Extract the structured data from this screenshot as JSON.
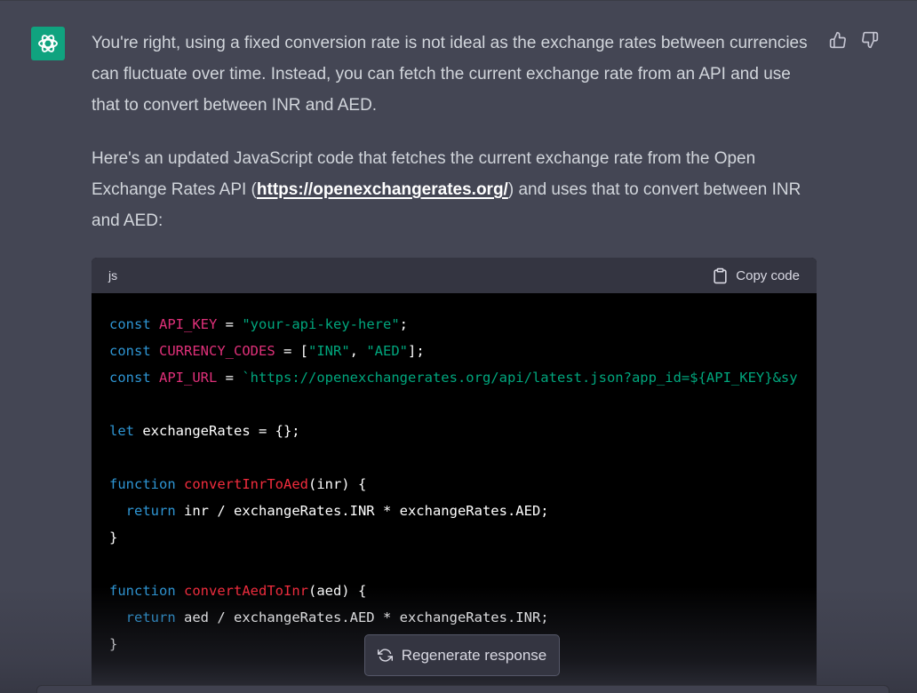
{
  "message": {
    "paragraph1": "You're right, using a fixed conversion rate is not ideal as the exchange rates between currencies can fluctuate over time. Instead, you can fetch the current exchange rate from an API and use that to convert between INR and AED.",
    "paragraph2_before": "Here's an updated JavaScript code that fetches the current exchange rate from the Open Exchange Rates API (",
    "paragraph2_link": "https://openexchangerates.org/",
    "paragraph2_after": ") and uses that to convert between INR and AED:"
  },
  "code": {
    "language": "js",
    "copy_label": "Copy code",
    "lines": [
      [
        {
          "t": "const",
          "c": "kw"
        },
        {
          "t": " "
        },
        {
          "t": "API_KEY",
          "c": "var"
        },
        {
          "t": " = "
        },
        {
          "t": "\"your-api-key-here\"",
          "c": "str"
        },
        {
          "t": ";"
        }
      ],
      [
        {
          "t": "const",
          "c": "kw"
        },
        {
          "t": " "
        },
        {
          "t": "CURRENCY_CODES",
          "c": "var"
        },
        {
          "t": " = ["
        },
        {
          "t": "\"INR\"",
          "c": "str"
        },
        {
          "t": ", "
        },
        {
          "t": "\"AED\"",
          "c": "str"
        },
        {
          "t": "];"
        }
      ],
      [
        {
          "t": "const",
          "c": "kw"
        },
        {
          "t": " "
        },
        {
          "t": "API_URL",
          "c": "var"
        },
        {
          "t": " = "
        },
        {
          "t": "`https://openexchangerates.org/api/latest.json?app_id=${API_KEY}&sy",
          "c": "str"
        }
      ],
      [],
      [
        {
          "t": "let",
          "c": "kw"
        },
        {
          "t": " exchangeRates = {};"
        }
      ],
      [],
      [
        {
          "t": "function",
          "c": "kw"
        },
        {
          "t": " "
        },
        {
          "t": "convertInrToAed",
          "c": "fn"
        },
        {
          "t": "(inr) {"
        }
      ],
      [
        {
          "t": "  "
        },
        {
          "t": "return",
          "c": "kw"
        },
        {
          "t": " inr / exchangeRates.INR * exchangeRates.AED;"
        }
      ],
      [
        {
          "t": "}"
        }
      ],
      [],
      [
        {
          "t": "function",
          "c": "kw"
        },
        {
          "t": " "
        },
        {
          "t": "convertAedToInr",
          "c": "fn"
        },
        {
          "t": "(aed) {"
        }
      ],
      [
        {
          "t": "  "
        },
        {
          "t": "return",
          "c": "kw"
        },
        {
          "t": " aed / exchangeRates.AED * exchangeRates.INR;"
        }
      ],
      [
        {
          "t": "}"
        }
      ]
    ]
  },
  "regenerate_label": "Regenerate response",
  "colors": {
    "background": "#444654",
    "avatar": "#10a37f",
    "keyword": "#2e95d3",
    "variable": "#df3079",
    "string": "#00a67d",
    "function": "#f22c3d"
  },
  "icons": {
    "avatar": "openai-logo-icon",
    "thumbs_up": "thumbs-up-icon",
    "thumbs_down": "thumbs-down-icon",
    "copy": "clipboard-icon",
    "regenerate": "refresh-icon"
  }
}
